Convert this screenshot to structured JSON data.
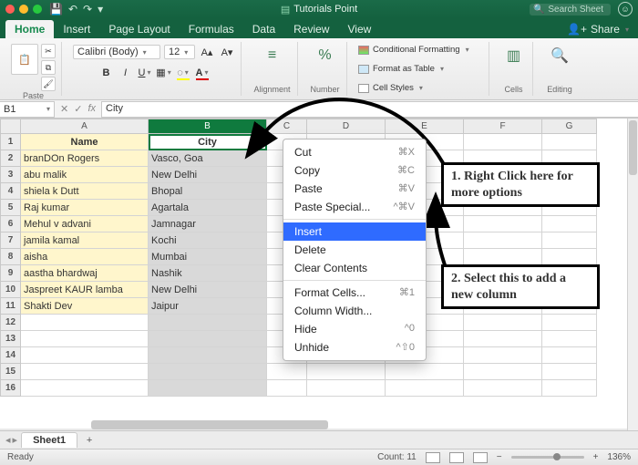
{
  "titlebar": {
    "doc_title": "Tutorials Point",
    "search_placeholder": "Search Sheet"
  },
  "tabs": {
    "items": [
      "Home",
      "Insert",
      "Page Layout",
      "Formulas",
      "Data",
      "Review",
      "View"
    ],
    "active": "Home",
    "share": "Share"
  },
  "ribbon": {
    "paste": "Paste",
    "font_name": "Calibri (Body)",
    "font_size": "12",
    "alignment": "Alignment",
    "number_group": "Number",
    "percent": "%",
    "cond_fmt": "Conditional Formatting",
    "as_table": "Format as Table",
    "cell_styles": "Cell Styles",
    "cells": "Cells",
    "editing": "Editing"
  },
  "namebox": {
    "ref": "B1",
    "formula": "City",
    "fx": "fx"
  },
  "columns": [
    "A",
    "B",
    "C",
    "D",
    "E",
    "F",
    "G"
  ],
  "selected_column": "B",
  "headers": {
    "name": "Name",
    "city": "City"
  },
  "rows": [
    {
      "name": "branDOn Rogers",
      "city": "Vasco, Goa"
    },
    {
      "name": "abu malik",
      "city": "New Delhi"
    },
    {
      "name": "shiela k Dutt",
      "city": "Bhopal"
    },
    {
      "name": "Raj kumar",
      "city": "Agartala"
    },
    {
      "name": "Mehul v advani",
      "city": "Jamnagar"
    },
    {
      "name": "jamila kamal",
      "city": "Kochi"
    },
    {
      "name": "aisha",
      "city": "Mumbai"
    },
    {
      "name": "aastha bhardwaj",
      "city": "Nashik"
    },
    {
      "name": "Jaspreet KAUR lamba",
      "city": "New Delhi"
    },
    {
      "name": "Shakti Dev",
      "city": "Jaipur"
    }
  ],
  "context_menu": {
    "items": [
      {
        "label": "Cut",
        "shortcut": "⌘X"
      },
      {
        "label": "Copy",
        "shortcut": "⌘C"
      },
      {
        "label": "Paste",
        "shortcut": "⌘V"
      },
      {
        "label": "Paste Special...",
        "shortcut": "^⌘V"
      },
      {
        "sep": true
      },
      {
        "label": "Insert",
        "highlight": true
      },
      {
        "label": "Delete"
      },
      {
        "label": "Clear Contents"
      },
      {
        "sep": true
      },
      {
        "label": "Format Cells...",
        "shortcut": "⌘1"
      },
      {
        "label": "Column Width..."
      },
      {
        "label": "Hide",
        "shortcut": "^0"
      },
      {
        "label": "Unhide",
        "shortcut": "^⇧0"
      }
    ]
  },
  "callouts": {
    "c1": "1. Right Click here for more options",
    "c2": "2. Select this to add a new column"
  },
  "sheet_tabs": {
    "active": "Sheet1"
  },
  "status": {
    "ready": "Ready",
    "count": "Count: 11",
    "zoom": "136%"
  }
}
